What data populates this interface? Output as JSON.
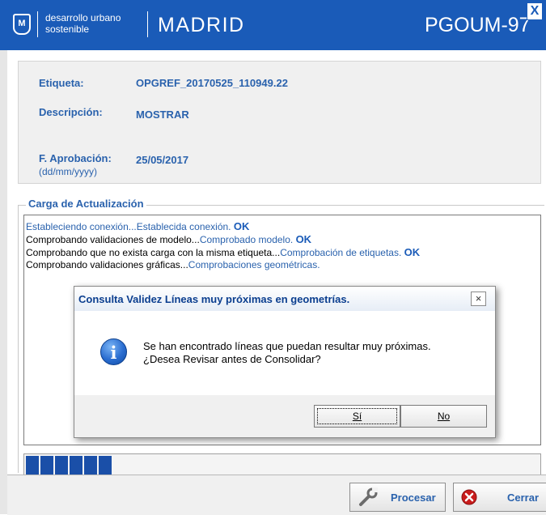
{
  "header": {
    "crest_glyph": "M",
    "department_line1": "desarrollo urbano",
    "department_line2": "sostenible",
    "city": "MADRID",
    "plan": "PGOUM-97",
    "close_glyph": "X"
  },
  "form": {
    "etiqueta_label": "Etiqueta:",
    "etiqueta_value": "OPGREF_20170525_110949.22",
    "descripcion_label": "Descripción:",
    "descripcion_value": "MOSTRAR",
    "aprobacion_label": "F. Aprobación:",
    "aprobacion_format": "(dd/mm/yyyy)",
    "aprobacion_value": "25/05/2017"
  },
  "carga": {
    "group_label": "Carga de Actualización",
    "log": [
      {
        "action": "Estableciendo conexión...",
        "status": "Establecida conexión.",
        "ok": "OK"
      },
      {
        "action": "Comprobando validaciones de modelo...",
        "status": "Comprobado modelo.",
        "ok": "OK"
      },
      {
        "action": "Comprobando que no exista carga con la misma etiqueta...",
        "status": "Comprobación de etiquetas.",
        "ok": "OK"
      },
      {
        "action": "Comprobando validaciones gráficas...",
        "status": "Comprobaciones geométricas.",
        "ok": ""
      }
    ],
    "progress_blocks_filled": 6
  },
  "footer": {
    "procesar_label": "Procesar",
    "cerrar_label": "Cerrar"
  },
  "dialog": {
    "title": "Consulta Validez Líneas muy próximas en geometrías.",
    "close_glyph": "×",
    "icon_glyph": "i",
    "message_line1": "Se han encontrado líneas que puedan resultar muy próximas.",
    "message_line2": "¿Desea Revisar antes de Consolidar?",
    "yes_label": "Sí",
    "no_label": "No"
  },
  "colors": {
    "header_blue": "#1a5bb8",
    "label_blue": "#2a62ad",
    "progress_blue": "#1a4fa8"
  }
}
